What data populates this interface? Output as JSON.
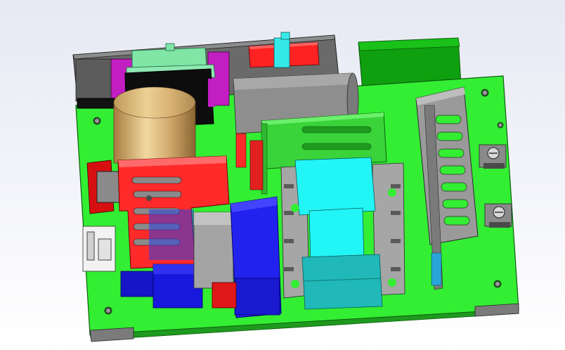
{
  "scene": {
    "subject": "power-supply-pcb-assembly",
    "colors": {
      "background_top": "#e6e9f3",
      "pcb": "#33ee33",
      "pcb_edge": "#1e9a1e",
      "chassis": "#6e6e6e",
      "heatsink_red": "#ff2a2a",
      "heatsink_green": "#3ad43a",
      "heatsink_gray": "#9a9a9a",
      "transformer_core": "#22f5f5",
      "transformer_base": "#20b8b8",
      "inductor_copper": "#d4a860",
      "capacitor_blue": "#2222ee",
      "magenta": "#c21ec2",
      "mint": "#7fe6a6",
      "dark_green": "#0fa00f"
    }
  }
}
